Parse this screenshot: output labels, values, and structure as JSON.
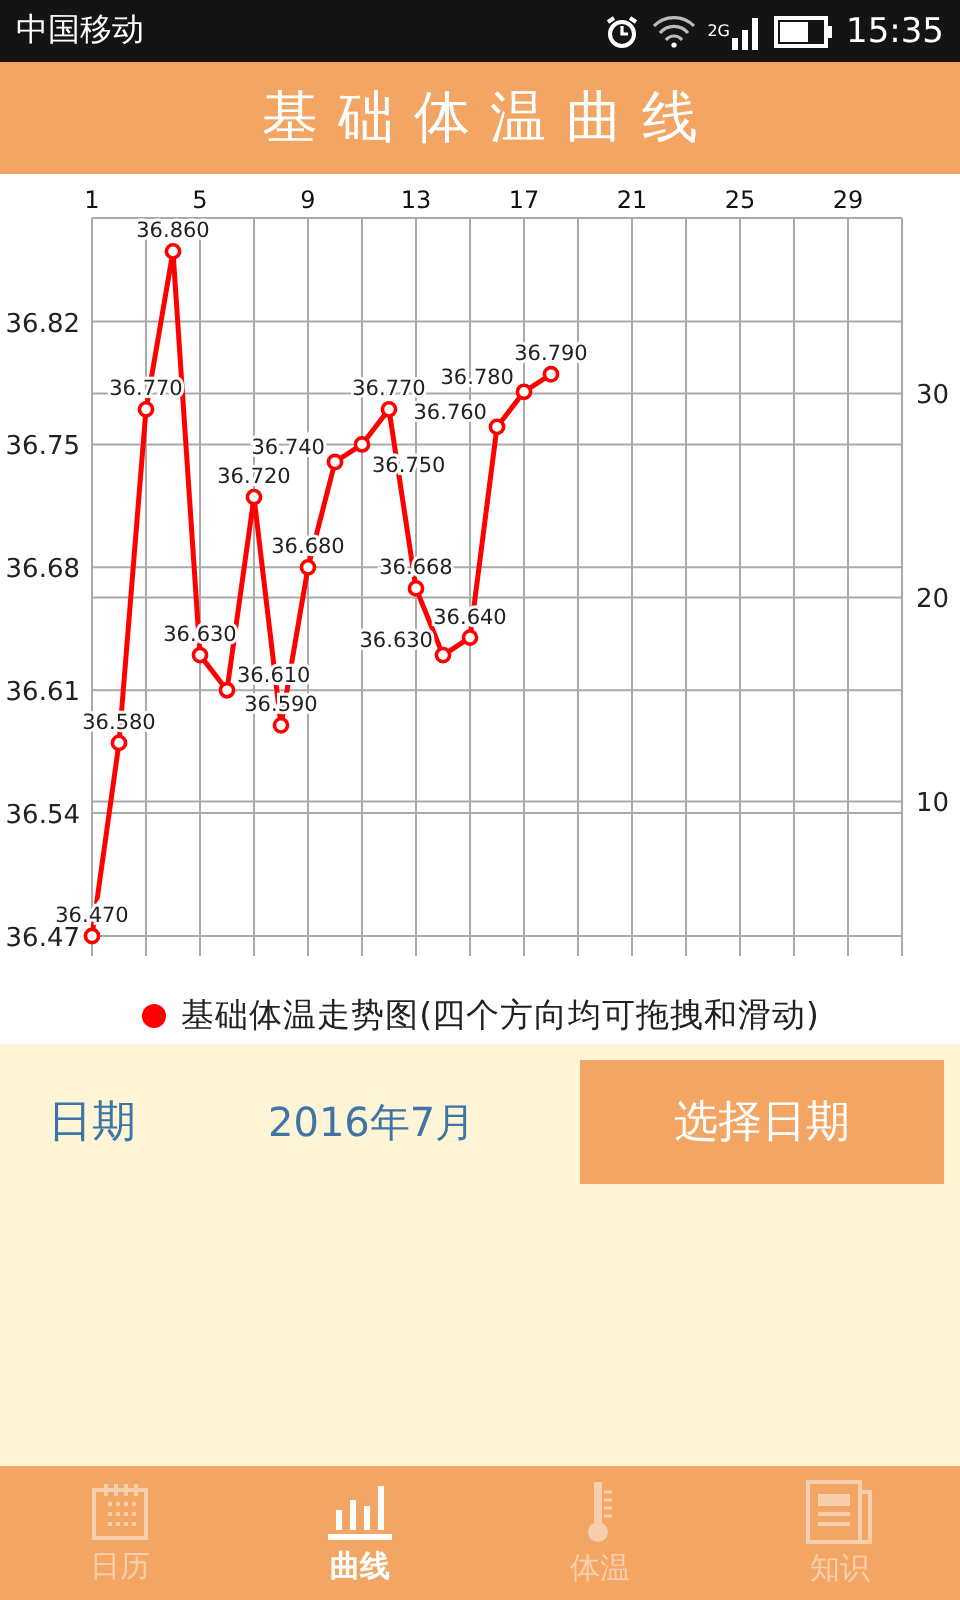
{
  "status_bar": {
    "carrier": "中国移动",
    "network": "2G",
    "time": "15:35"
  },
  "header": {
    "title": "基础体温曲线"
  },
  "chart": {
    "chart_data": {
      "type": "line",
      "x": [
        1,
        2,
        3,
        4,
        5,
        6,
        7,
        8,
        9,
        10,
        11,
        12,
        13,
        14,
        15,
        16,
        17,
        18
      ],
      "series": [
        {
          "name": "基础体温走势图(四个方向均可拖拽和滑动)",
          "color": "#ff0000",
          "marker": "circle",
          "values": [
            36.47,
            36.58,
            36.77,
            36.86,
            36.63,
            36.61,
            36.72,
            36.59,
            36.68,
            36.74,
            36.75,
            36.77,
            36.668,
            36.63,
            36.64,
            36.76,
            36.78,
            36.79
          ]
        }
      ],
      "xlim": [
        1,
        31
      ],
      "ylim": [
        36.47,
        36.879
      ],
      "xticks": [
        1,
        5,
        9,
        13,
        17,
        21,
        25,
        29
      ],
      "yticks": [
        36.47,
        36.54,
        36.61,
        36.68,
        36.75,
        36.82
      ],
      "y2ticks": [
        10,
        20,
        30
      ],
      "y2lim": [
        3.4,
        38.6
      ],
      "grid": true,
      "value_labels": [
        "36.470",
        "36.580",
        "36.770",
        "36.860",
        "36.630",
        "36.610",
        "36.720",
        "36.590",
        "36.680",
        "36.740",
        "36.750",
        "36.770",
        "36.668",
        "36.630",
        "36.640",
        "36.760",
        "36.780",
        "36.790"
      ]
    }
  },
  "date_row": {
    "label": "日期",
    "value": "2016年7月",
    "button": "选择日期"
  },
  "tabs": [
    {
      "label": "日历",
      "selected": false
    },
    {
      "label": "曲线",
      "selected": true
    },
    {
      "label": "体温",
      "selected": false
    },
    {
      "label": "知识",
      "selected": false
    }
  ]
}
